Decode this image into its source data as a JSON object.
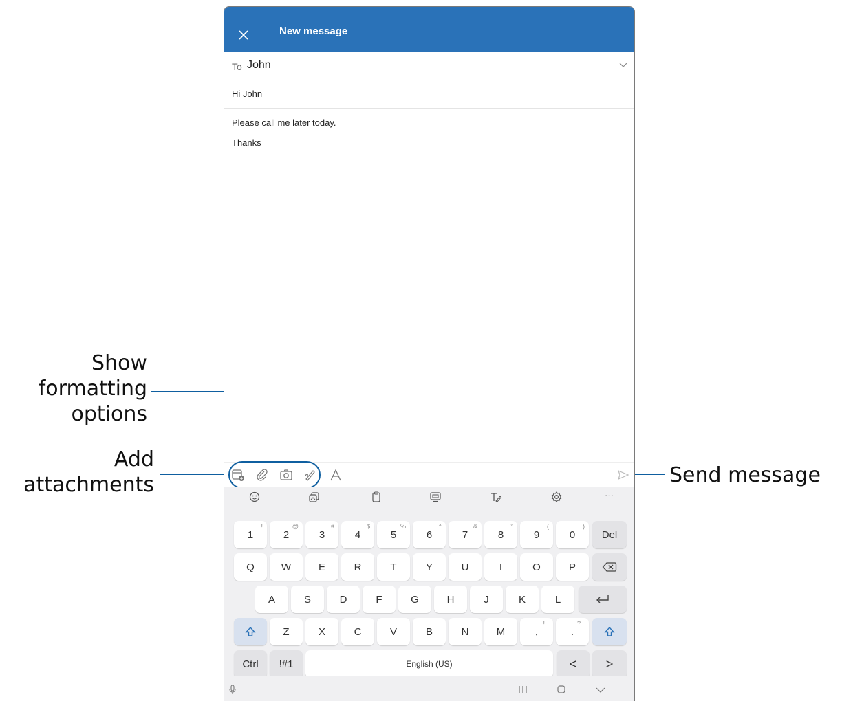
{
  "annotations": {
    "formatting_label": [
      "Show",
      "formatting",
      "options"
    ],
    "attachments_label": [
      "Add",
      "attachments"
    ],
    "send_label": "Send message"
  },
  "app": {
    "title": "New message",
    "to_label": "To",
    "to_value": "John",
    "subject": "Hi John",
    "body_lines": [
      "Please call me later today.",
      "Thanks"
    ]
  },
  "toolbar_icons": [
    "calendar-add-icon",
    "paperclip-icon",
    "camera-icon",
    "draw-icon",
    "text-format-icon",
    "send-icon"
  ],
  "keyboard": {
    "tools": [
      "emoji-icon",
      "sticker-icon",
      "clipboard-icon",
      "screen-icon",
      "handwriting-icon",
      "settings-icon",
      "more-icon"
    ],
    "more_label": "···",
    "row1": [
      {
        "k": "1",
        "s": "!"
      },
      {
        "k": "2",
        "s": "@"
      },
      {
        "k": "3",
        "s": "#"
      },
      {
        "k": "4",
        "s": "$"
      },
      {
        "k": "5",
        "s": "%"
      },
      {
        "k": "6",
        "s": "^"
      },
      {
        "k": "7",
        "s": "&"
      },
      {
        "k": "8",
        "s": "*"
      },
      {
        "k": "9",
        "s": "("
      },
      {
        "k": "0",
        "s": ")"
      }
    ],
    "del_label": "Del",
    "row2": [
      "Q",
      "W",
      "E",
      "R",
      "T",
      "Y",
      "U",
      "I",
      "O",
      "P"
    ],
    "row3": [
      "A",
      "S",
      "D",
      "F",
      "G",
      "H",
      "J",
      "K",
      "L"
    ],
    "row4": [
      "Z",
      "X",
      "C",
      "V",
      "B",
      "N",
      "M"
    ],
    "comma": {
      "k": ",",
      "s": "!"
    },
    "period": {
      "k": ".",
      "s": "?"
    },
    "ctrl_label": "Ctrl",
    "symbols_label": "!#1",
    "space_label": "English (US)",
    "left_label": "<",
    "right_label": ">"
  },
  "colors": {
    "accent": "#0f5fa0",
    "appbar": "#2a72b8",
    "keyboard_bg": "#f0f0f2"
  }
}
